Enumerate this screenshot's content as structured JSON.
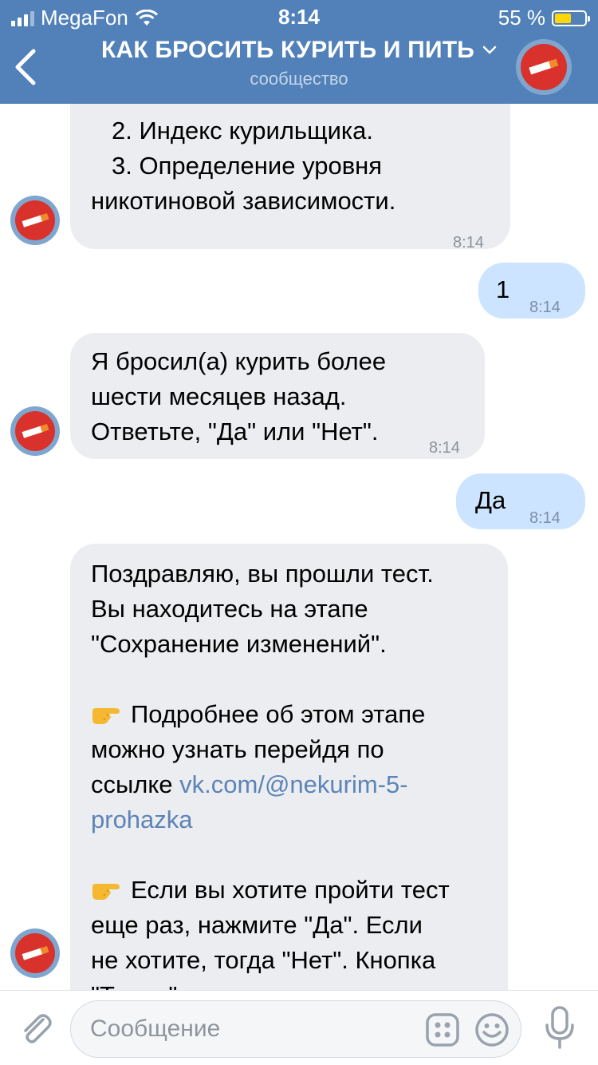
{
  "status_bar": {
    "carrier": "MegaFon",
    "time": "8:14",
    "battery": "55 %",
    "battery_level": 0.55
  },
  "header": {
    "title": "КАК БРОСИТЬ КУРИТЬ И ПИТЬ",
    "subtitle": "сообщество",
    "title_icon": "chevron-down-icon"
  },
  "messages": [
    {
      "lines": [
        "2. Индекс курильщика.",
        "3. Определение уровня",
        "никотиновой зависимости."
      ],
      "time": "8:14"
    },
    {
      "text": "1",
      "time": "8:14"
    },
    {
      "lines": [
        "Я бросил(а) курить более",
        "шести месяцев назад.",
        "Ответьте, \"Да\" или \"Нет\"."
      ],
      "time": "8:14"
    },
    {
      "text": "Да",
      "time": "8:14"
    },
    {
      "l1": "Поздравляю, вы прошли тест.",
      "l2": "Вы находитесь на этапе",
      "l3": "\"Сохранение изменений\".",
      "l4": "Подробнее об этом этапе",
      "l5": "можно узнать перейдя по",
      "l6": "ссылке",
      "link1": "vk.com/@nekurim-5-",
      "link2": "prohazka",
      "l7": "Если вы хотите пройти тест",
      "l8": "еще раз, нажмите \"Да\". Если",
      "l9": "не хотите, тогда \"Нет\". Кнопка",
      "l10": "\"Тесты\" выводит список"
    }
  ],
  "input": {
    "placeholder": "Сообщение"
  },
  "colors": {
    "header_bg": "#5181b8",
    "incoming_bubble": "#ebedf0",
    "outgoing_bubble": "#cce4ff",
    "link": "#5d84b7",
    "battery": "#ffd60a"
  }
}
